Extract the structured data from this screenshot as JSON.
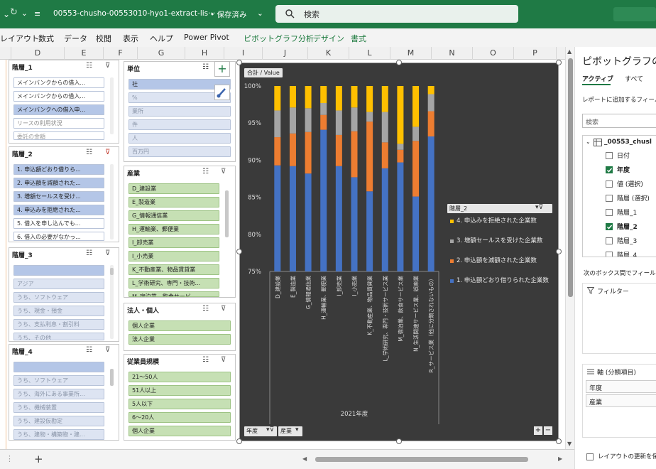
{
  "titlebar": {
    "undo_icon": "undo-icon",
    "filename": "00553-chusho-00553010-hyo1-extract-lis···",
    "status": "• 保存済み",
    "search_placeholder": "検索"
  },
  "menu": [
    "レイアウト",
    "数式",
    "データ",
    "校閲",
    "表示",
    "ヘルプ",
    "Power Pivot",
    "ピボットグラフ分析",
    "デザイン",
    "書式"
  ],
  "columns": [
    "D",
    "E",
    "F",
    "G",
    "H",
    "I",
    "J",
    "K",
    "L",
    "M",
    "N",
    "O",
    "P"
  ],
  "slicers": {
    "kaisou1": {
      "title": "階層_1",
      "items": [
        "メインバンクからの借入...",
        "メインバンクからの借入...",
        "メインバンクへの借入申...",
        "リースの利用状況",
        "委託の金額"
      ]
    },
    "kaisou2": {
      "title": "階層_2",
      "items": [
        "1. 申込額どおり借りら...",
        "2. 申込額を減額された...",
        "3. 増額セールスを受け...",
        "4. 申込みを拒絶された...",
        "5. 借入を申し込んでも...",
        "6. 借入の必要がなかっ..."
      ]
    },
    "kaisou3": {
      "title": "階層_3",
      "items": [
        "",
        "アジア",
        "うち、ソフトウェア",
        "うち、現金・預金",
        "うち、支払利息・割引料",
        "うち、その他"
      ]
    },
    "kaisou4": {
      "title": "階層_4",
      "items": [
        "",
        "うち、ソフトウェア",
        "うち、海外にある事業所...",
        "うち、機械装置",
        "うち、建設仮勘定",
        "うち、建物・構築物・建..."
      ]
    },
    "tani": {
      "title": "単位",
      "items": [
        "社",
        "%",
        "業所",
        "件",
        "人",
        "百万円"
      ]
    },
    "sangyo": {
      "title": "産業",
      "items": [
        "D_建設業",
        "E_製造業",
        "G_情報通信業",
        "H_運輸業、郵便業",
        "I_卸売業",
        "I_小売業",
        "K_不動産業、物品賃貸業",
        "L_学術研究、専門・技術...",
        "M_宿泊業、飲食サービ..."
      ]
    },
    "hojin": {
      "title": "法人・個人",
      "items": [
        "個人企業",
        "法人企業"
      ]
    },
    "jugyoin": {
      "title": "従業員規模",
      "items": [
        "21～50人",
        "51人以上",
        "5人以下",
        "6～20人",
        "個人企業"
      ]
    }
  },
  "chart": {
    "value_field_button": "合計 / Value",
    "legend_title": "階層_2",
    "x_group_label": "2021年度",
    "axis_buttons": [
      "年度",
      "産業"
    ],
    "zoom_buttons": [
      "+",
      "−"
    ]
  },
  "chart_data": {
    "type": "bar",
    "stacked": "percent",
    "ylim": [
      75,
      100
    ],
    "yticks": [
      "75%",
      "80%",
      "85%",
      "90%",
      "95%",
      "100%"
    ],
    "categories": [
      "D_建設業",
      "E_製造業",
      "G_情報通信業",
      "H_運輸業、郵便業",
      "I_卸売業",
      "I_小売業",
      "K_不動産業、物品賃貸業",
      "L_学術研究、専門・技術サービス業",
      "M_宿泊業、飲食サービス業",
      "N_生活関連サービス業、娯楽業",
      "R_サービス業（他に分類されないもの）"
    ],
    "series": [
      {
        "name": "1. 申込額どおり借りられた企業数",
        "color": "#4472c4",
        "values": [
          89.3,
          89.2,
          88.2,
          94.1,
          89.2,
          87.7,
          85.8,
          88.9,
          89.7,
          85.1,
          93.2
        ]
      },
      {
        "name": "2. 申込額を減額された企業数",
        "color": "#ed7d31",
        "values": [
          3.8,
          4.4,
          5.6,
          2.0,
          4.2,
          6.2,
          9.4,
          3.5,
          1.7,
          7.5,
          3.4
        ]
      },
      {
        "name": "3. 増額セールスを受けた企業数",
        "color": "#a5a5a5",
        "values": [
          3.6,
          3.5,
          3.2,
          1.6,
          3.3,
          3.2,
          1.3,
          4.1,
          0.8,
          1.9,
          2.3
        ]
      },
      {
        "name": "4. 申込みを拒絶された企業数",
        "color": "#ffc000",
        "values": [
          3.3,
          2.9,
          3.0,
          2.3,
          3.3,
          2.9,
          3.5,
          3.5,
          7.8,
          5.5,
          1.1
        ]
      }
    ]
  },
  "pivot_pane": {
    "title": "ピボットグラフの",
    "tab_active": "アクティブ",
    "tab_all": "すべて",
    "report_add_label": "レポートに追加するフィール",
    "search_placeholder": "検索",
    "table_name": "_00553_chusl",
    "fields": [
      {
        "label": "日付",
        "checked": false
      },
      {
        "label": "年度",
        "checked": true
      },
      {
        "label": "値 (選択)",
        "checked": false
      },
      {
        "label": "階層 (選択)",
        "checked": false
      },
      {
        "label": "階層_1",
        "checked": false
      },
      {
        "label": "階層_2",
        "checked": true
      },
      {
        "label": "階層_3",
        "checked": false
      },
      {
        "label": "階層_4",
        "checked": false
      }
    ],
    "drag_label": "次のボックス間でフィールド",
    "filter_label": "フィルター",
    "axis_label": "軸 (分類項目)",
    "axis_items": [
      "年度",
      "産業"
    ],
    "defer_label": "レイアウトの更新を保"
  },
  "bottom": {
    "add_sheet": "+"
  }
}
